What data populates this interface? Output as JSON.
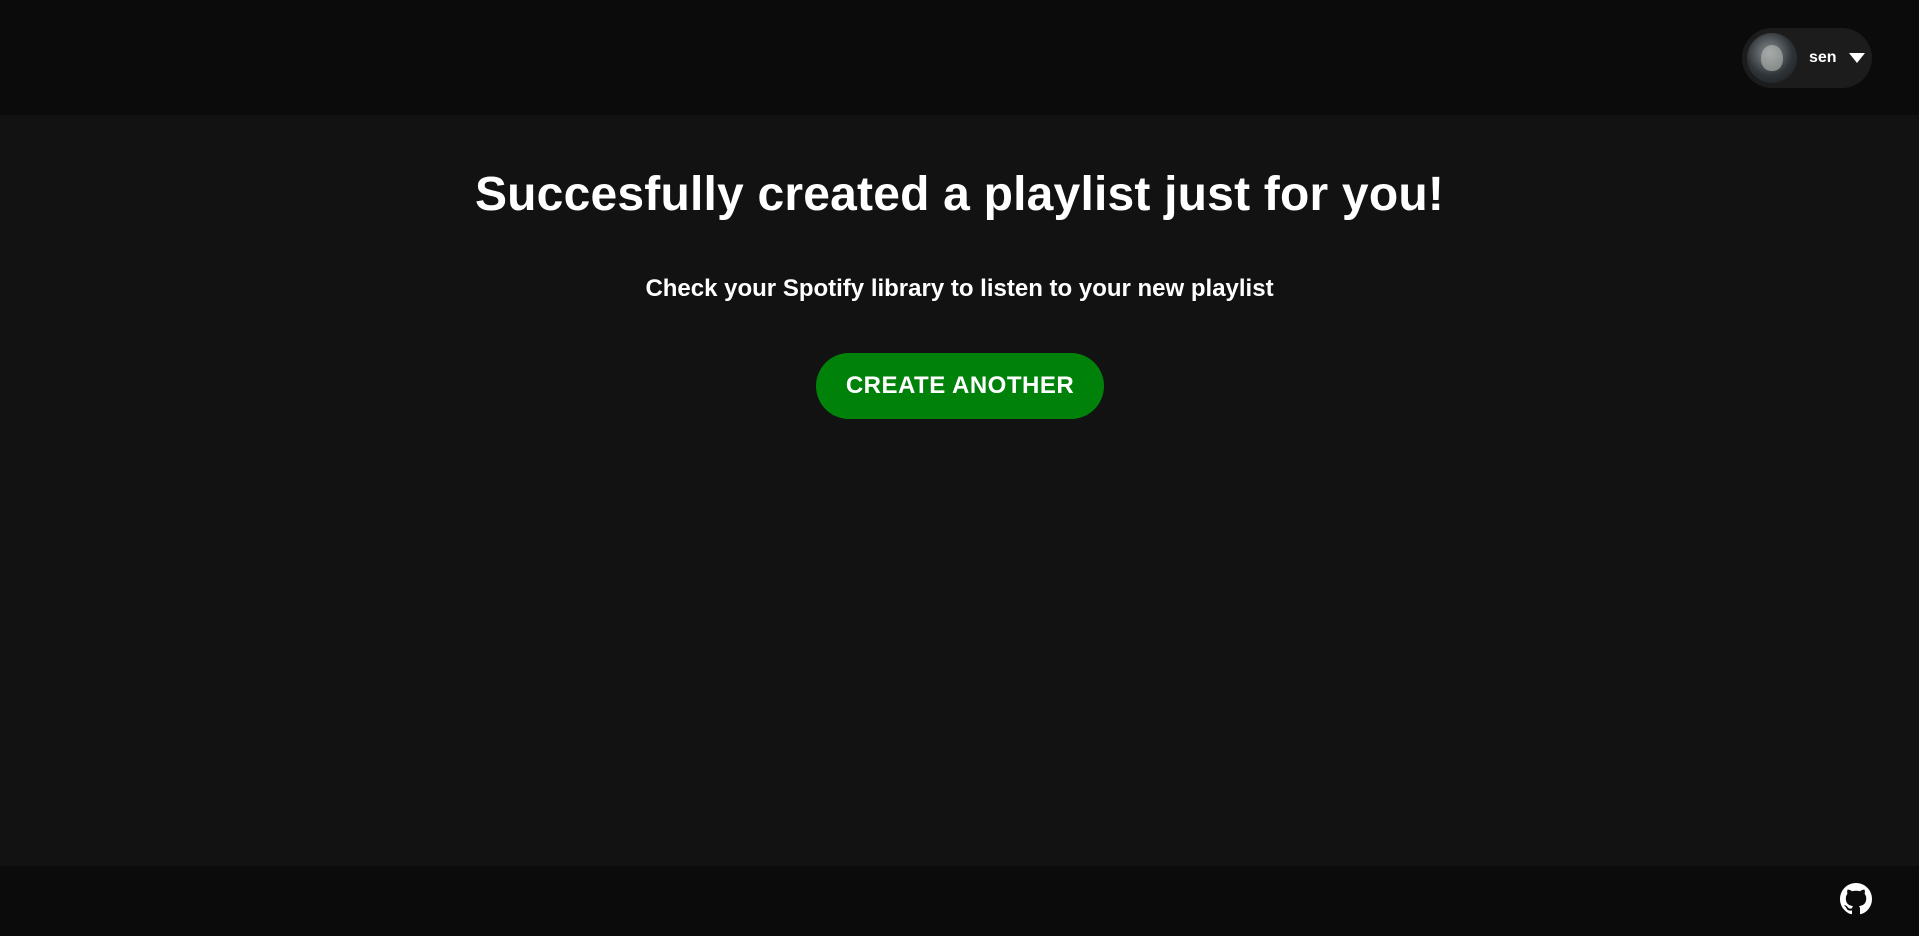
{
  "header": {
    "user": {
      "name": "sen",
      "avatar_alt": "user avatar"
    }
  },
  "main": {
    "title": "Succesfully created a playlist just for you!",
    "subtitle": "Check your Spotify library to listen to your new playlist",
    "cta_label": "CREATE ANOTHER"
  },
  "footer": {
    "github_icon": "github-icon"
  },
  "colors": {
    "background": "#121212",
    "bar_background": "#0b0b0b",
    "pill_background": "#1c1c1c",
    "accent_green": "#00820a",
    "text": "#ffffff"
  }
}
